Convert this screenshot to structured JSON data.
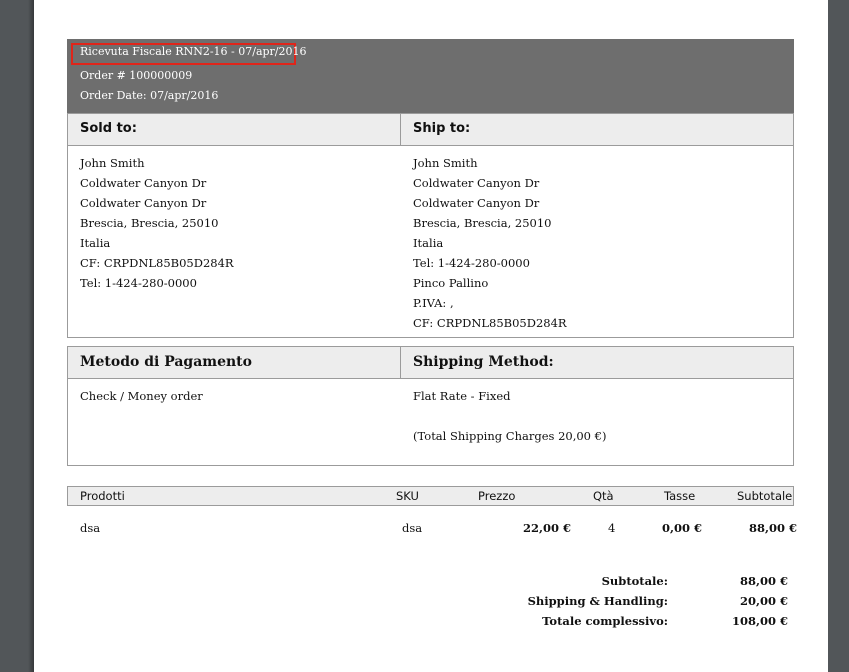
{
  "header": {
    "receipt": "Ricevuta Fiscale RNN2-16 - 07/apr/2016",
    "order": "Order # 100000009",
    "order_date": "Order Date: 07/apr/2016"
  },
  "address": {
    "sold_to_title": "Sold to:",
    "ship_to_title": "Ship to:",
    "sold_to": [
      "John Smith",
      "Coldwater Canyon Dr",
      "Coldwater Canyon Dr",
      "Brescia, Brescia, 25010",
      "Italia",
      "CF: CRPDNL85B05D284R",
      "Tel: 1-424-280-0000"
    ],
    "ship_to": [
      "John Smith",
      "Coldwater Canyon Dr",
      "Coldwater Canyon Dr",
      "Brescia, Brescia, 25010",
      "Italia",
      "Tel: 1-424-280-0000",
      "Pinco Pallino",
      "P.IVA: ,",
      "CF: CRPDNL85B05D284R"
    ]
  },
  "payment": {
    "payment_title": "Metodo di Pagamento",
    "shipping_title": "Shipping Method:",
    "payment_method": "Check / Money order",
    "shipping_method": "Flat Rate - Fixed",
    "shipping_charges": "(Total Shipping Charges 20,00 €)"
  },
  "items": {
    "columns": {
      "product": "Prodotti",
      "sku": "SKU",
      "price": "Prezzo",
      "qty": "Qtà",
      "tax": "Tasse",
      "subtotal": "Subtotale"
    },
    "rows": [
      {
        "product": "dsa",
        "sku": "dsa",
        "price": "22,00 €",
        "qty": "4",
        "tax": "0,00 €",
        "subtotal": "88,00 €"
      }
    ]
  },
  "totals": {
    "subtotal_label": "Subtotale:",
    "subtotal_value": "88,00 €",
    "shipping_label": "Shipping & Handling:",
    "shipping_value": "20,00 €",
    "grand_label": "Totale complessivo:",
    "grand_value": "108,00 €"
  },
  "colors": {
    "banner": "#6e6e6e",
    "highlight": "#e0251a",
    "header_bg": "#ededed",
    "viewer_bg": "#525659"
  }
}
